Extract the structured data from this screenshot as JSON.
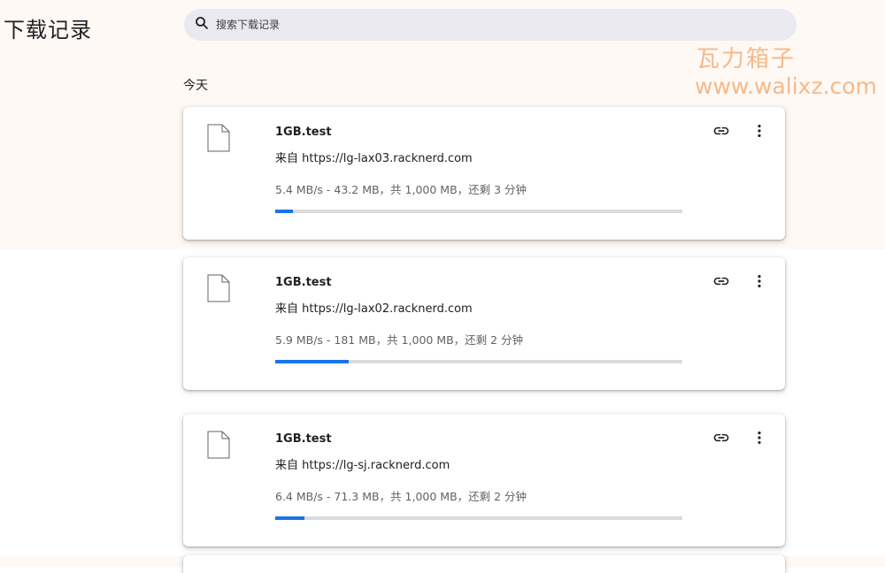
{
  "page_title": "下载记录",
  "search": {
    "placeholder": "搜索下载记录",
    "icon": "search-icon"
  },
  "watermark": {
    "line1": "瓦力箱子",
    "line2": "www.walixz.com",
    "color": "#f5b98a"
  },
  "section_label": "今天",
  "accent_color": "#1a73e8",
  "downloads": [
    {
      "file_name": "1GB.test",
      "source": "来自 https://lg-lax03.racknerd.com",
      "status": "5.4 MB/s - 43.2 MB，共 1,000 MB，还剩 3 分钟",
      "progress": 0.0432
    },
    {
      "file_name": "1GB.test",
      "source": "来自 https://lg-lax02.racknerd.com",
      "status": "5.9 MB/s - 181 MB，共 1,000 MB，还剩 2 分钟",
      "progress": 0.181
    },
    {
      "file_name": "1GB.test",
      "source": "来自 https://lg-sj.racknerd.com",
      "status": "6.4 MB/s - 71.3 MB，共 1,000 MB，还剩 2 分钟",
      "progress": 0.0713
    }
  ]
}
